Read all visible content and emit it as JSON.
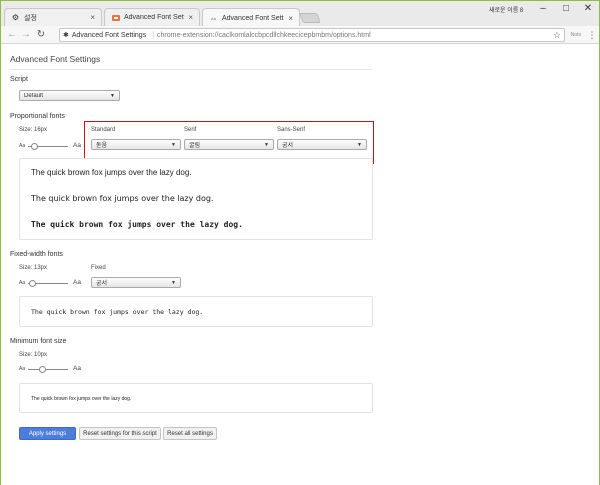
{
  "tabs": [
    {
      "label": "설정",
      "icon": "gear-icon",
      "active": false
    },
    {
      "label": "Advanced Font Settings",
      "icon": "font-ext-icon",
      "active": false
    },
    {
      "label": "Advanced Font Settings",
      "icon": "font-ext-icon",
      "active": true
    }
  ],
  "profile_name": "새로운 이름 8",
  "address_bar": {
    "extension_name": "Advanced Font Settings",
    "url": "chrome-extension://caclkomlalccbpcdllchkeecicepbmbm/options.html"
  },
  "extension_badge": "Noto",
  "page": {
    "title": "Advanced Font Settings",
    "script": {
      "label": "Script",
      "value": "Default"
    },
    "proportional": {
      "label": "Proportional fonts",
      "size_label": "Size: 16px",
      "slider_level": 0.15,
      "aa_small": "Aa",
      "aa_big": "Aa",
      "standard": {
        "label": "Standard",
        "value": "돋움"
      },
      "serif": {
        "label": "Serif",
        "value": "굴림"
      },
      "sans_serif": {
        "label": "Sans-Serif",
        "value": "궁서"
      },
      "samples": [
        "The quick brown fox jumps over the lazy dog.",
        "The quick brown fox jumps over the lazy dog.",
        "The quick brown fox jumps over the lazy dog."
      ]
    },
    "fixed": {
      "label": "Fixed-width fonts",
      "size_label": "Size: 13px",
      "slider_level": 0.1,
      "aa_small": "Aa",
      "aa_big": "Aa",
      "fixed_font": {
        "label": "Fixed",
        "value": "궁서"
      },
      "sample": "The quick brown fox jumps over the lazy dog."
    },
    "minimum": {
      "label": "Minimum font size",
      "size_label": "Size: 10px",
      "slider_level": 0.35,
      "aa_small": "Aa",
      "aa_big": "Aa",
      "sample": "The quick brown fox jumps over the lazy dog."
    },
    "buttons": {
      "apply": "Apply settings",
      "reset_script": "Reset settings for this script",
      "reset_all": "Reset all settings"
    }
  },
  "colors": {
    "highlight_border": "#c4151c",
    "primary_button": "#4d7ddb",
    "window_frame": "#9ac74a"
  }
}
